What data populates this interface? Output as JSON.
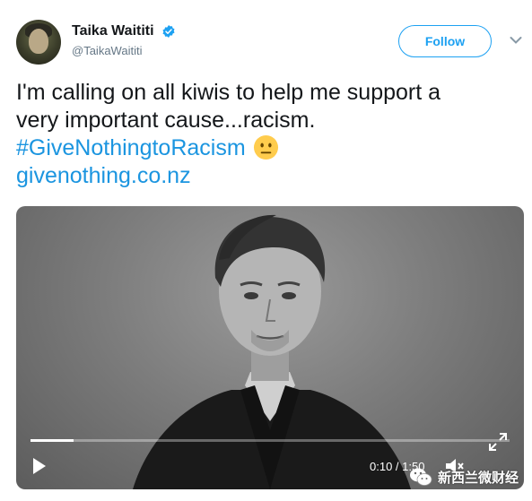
{
  "user": {
    "display_name": "Taika Waititi",
    "handle": "@TaikaWaititi",
    "verified": true
  },
  "follow_button": {
    "label": "Follow"
  },
  "tweet": {
    "line1": "I'm calling on all kiwis to help me support a",
    "line2": "very important cause...racism.",
    "hashtag": "#GiveNothingtoRacism",
    "emoji": "neutral-face-icon",
    "link": "givenothing.co.nz"
  },
  "video": {
    "time_display": "0:10 / 1:50",
    "progress_fraction": 0.09,
    "controls": [
      "play-icon",
      "volume-icon",
      "fullscreen-icon"
    ]
  },
  "watermark": {
    "text": "新西兰微财经",
    "icon": "wechat-icon"
  },
  "colors": {
    "link": "#1b95e0",
    "follow": "#1da1f2",
    "verified": "#1da1f2",
    "handle": "#657786"
  }
}
